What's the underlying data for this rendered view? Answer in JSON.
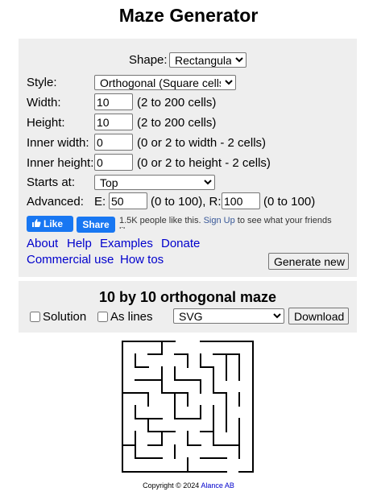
{
  "page": {
    "title": "Maze Generator"
  },
  "form": {
    "shape_label": "Shape:",
    "shape_value": "Rectangular",
    "style_label": "Style:",
    "style_value": "Orthogonal (Square cells)",
    "width_label": "Width:",
    "width_value": "10",
    "width_hint": "(2 to 200 cells)",
    "height_label": "Height:",
    "height_value": "10",
    "height_hint": "(2 to 200 cells)",
    "inner_width_label": "Inner width:",
    "inner_width_value": "0",
    "inner_width_hint": "(0 or 2 to width - 2 cells)",
    "inner_height_label": "Inner height:",
    "inner_height_value": "0",
    "inner_height_hint": "(0 or 2 to height - 2 cells)",
    "starts_label": "Starts at:",
    "starts_value": "Top",
    "advanced_label": "Advanced:",
    "e_label": "E:",
    "e_value": "50",
    "e_hint": "(0 to 100), R:",
    "r_value": "100",
    "r_hint": "(0 to 100)"
  },
  "facebook": {
    "like_label": "Like",
    "share_label": "Share",
    "count_text": "1.5K people like this.",
    "signup_link": "Sign Up",
    "signup_suffix": "to see what your friends like."
  },
  "links": {
    "about": "About",
    "help": "Help",
    "examples": "Examples",
    "donate": "Donate",
    "commercial": "Commercial use",
    "howtos": "How tos"
  },
  "generate_button": "Generate new",
  "maze_panel": {
    "title": "10 by 10 orthogonal maze",
    "solution_label": "Solution",
    "aslines_label": "As lines",
    "format_value": "SVG",
    "download_label": "Download"
  },
  "footer": {
    "copyright": "Copyright © 2024",
    "company": "Alance AB"
  }
}
